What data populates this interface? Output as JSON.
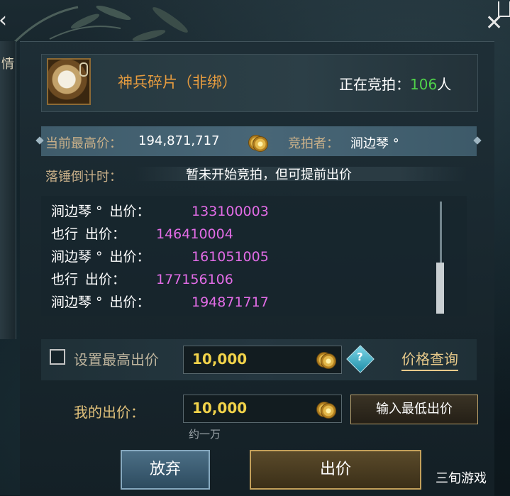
{
  "sidebar": {
    "glyph": "情"
  },
  "item": {
    "name": "神兵碎片（非绑）"
  },
  "auction": {
    "bidders_label": "正在竞拍：",
    "bidders_count": "106",
    "bidders_unit": "人",
    "highest_label": "当前最高价：",
    "highest_value": "194,871,717",
    "bidder_label": "竞拍者：",
    "bidder_name": "涧边琴 °",
    "countdown_label": "落锤倒计时：",
    "countdown_value": "暂未开始竞拍，但可提前出价"
  },
  "history": [
    {
      "name": "涧边琴 °",
      "label": "出价：",
      "amount": "133100003"
    },
    {
      "name": "也行",
      "label": "出价：",
      "amount": "146410004"
    },
    {
      "name": "涧边琴 °",
      "label": "出价：",
      "amount": "161051005"
    },
    {
      "name": "也行",
      "label": "出价：",
      "amount": "177156106"
    },
    {
      "name": "涧边琴 °",
      "label": "出价：",
      "amount": "194871717"
    }
  ],
  "max_bid": {
    "label": "设置最高出价",
    "value": "10,000",
    "checked": false,
    "price_query": "价格查询",
    "help": "?"
  },
  "my_bid": {
    "label": "我的出价：",
    "value": "10,000",
    "approx": "约一万",
    "min_button": "输入最低出价"
  },
  "buttons": {
    "give_up": "放弃",
    "bid": "出价"
  },
  "watermark": "三旬游戏",
  "colors": {
    "item_name": "#e79c3f",
    "bidder_count": "#4fd24a",
    "history_amount": "#e26ce6",
    "input_value": "#f2d34a"
  }
}
